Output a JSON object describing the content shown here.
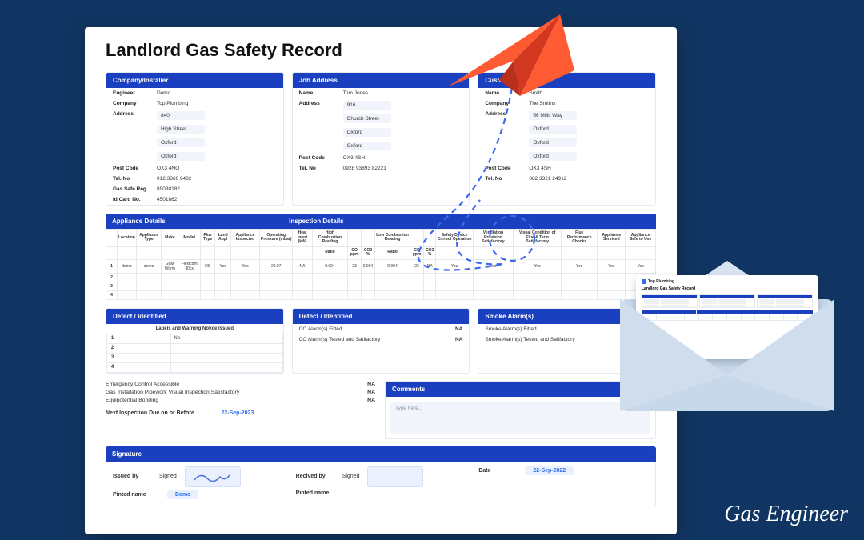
{
  "title": "Landlord Gas Safety Record",
  "cards": {
    "company": {
      "header": "Company/Installer",
      "engineer_k": "Engineer",
      "engineer_v": "Demo",
      "company_k": "Company",
      "company_v": "Top Plumbing",
      "address_k": "Address",
      "addr1": "840",
      "addr2": "High Street",
      "addr3": "Oxford",
      "addr4": "Oxford",
      "postcode_k": "Post Code",
      "postcode_v": "OX3 4NQ",
      "tel_k": "Tel. No",
      "tel_v": "012 3366 9482",
      "gas_k": "Gas Safe Reg",
      "gas_v": "89030182",
      "id_k": "Id Card No.",
      "id_v": "4501862"
    },
    "job": {
      "header": "Job Address",
      "name_k": "Name",
      "name_v": "Tom Jones",
      "address_k": "Address",
      "addr1": "916",
      "addr2": "Church Street",
      "addr3": "Oxford",
      "addr4": "Oxford",
      "postcode_k": "Post Code",
      "postcode_v": "OX3 4SH",
      "tel_k": "Tel. No",
      "tel_v": "0928 93893 82221"
    },
    "customer": {
      "header": "Customer/Landlord",
      "name_k": "Name",
      "name_v": "Smith",
      "company_k": "Company",
      "company_v": "The Smiths",
      "address_k": "Address",
      "addr1": "56 Mills Way",
      "addr2": "Oxford",
      "addr3": "Oxford",
      "addr4": "Oxford",
      "postcode_k": "Post Code",
      "postcode_v": "OX3 4SH",
      "tel_k": "Tel. No",
      "tel_v": "082 3321 24912"
    }
  },
  "appliance_hdr": "Appliance Details",
  "inspection_hdr": "Inspection Details",
  "wide_headers": [
    "",
    "Location",
    "Appliance Type",
    "Make",
    "Model",
    "Flue Type",
    "Land Appl",
    "Appliance Inspected",
    "Operating Pressure (mbar)",
    "Heat Input (kW)",
    "High Combustion Reading",
    "",
    "",
    "Low Combustion Reading",
    "",
    "",
    "Safety Device Correct Operation",
    "Ventilation Provision Satisfactory",
    "Visual Condition of Flue & Term Satisfactory",
    "Flue Performance Checks",
    "Appliance Serviced",
    "Appliance Safe to Use"
  ],
  "wide_sub": [
    "",
    "",
    "",
    "",
    "",
    "",
    "",
    "",
    "",
    "",
    "Ratio",
    "CO ppm",
    "CO2 %",
    "Ratio",
    "CO ppm",
    "CO2 %",
    "",
    "",
    "",
    "",
    "",
    ""
  ],
  "wide_rows": [
    [
      "1",
      "demo",
      "demo",
      "Glow Worm",
      "Flexicom 30cx",
      "RS",
      "Yes",
      "Yes",
      "20.07",
      "NA",
      "0.004",
      "23",
      "0.004",
      "0.004",
      "23",
      "NA",
      "Yes",
      "Yes",
      "Yes",
      "Yes",
      "Yes",
      "Yes"
    ],
    [
      "2",
      "",
      "",
      "",
      "",
      "",
      "",
      "",
      "",
      "",
      "",
      "",
      "",
      "",
      "",
      "",
      "",
      "",
      "",
      "",
      "",
      ""
    ],
    [
      "3",
      "",
      "",
      "",
      "",
      "",
      "",
      "",
      "",
      "",
      "",
      "",
      "",
      "",
      "",
      "",
      "",
      "",
      "",
      "",
      "",
      ""
    ],
    [
      "4",
      "",
      "",
      "",
      "",
      "",
      "",
      "",
      "",
      "",
      "",
      "",
      "",
      "",
      "",
      "",
      "",
      "",
      "",
      "",
      "",
      ""
    ]
  ],
  "defect1_hdr": "Defect / Identified",
  "defect1_sub": "Labels and Warning Notice Issued",
  "defect1_col": "No",
  "defect2_hdr": "Defect / Identified",
  "defect2_rows": [
    {
      "l": "CO Alarm(s) Fitted",
      "r": "NA"
    },
    {
      "l": "CO Alarm(s) Tested and Satifactory",
      "r": "NA"
    }
  ],
  "smoke_hdr": "Smoke Alarm(s)",
  "smoke_rows": [
    {
      "l": "Smoke Alarm(s) Fitted",
      "r": ""
    },
    {
      "l": "Smoke Alarm(s) Tested and Satifactory",
      "r": ""
    }
  ],
  "checks": [
    {
      "l": "Emergency Control Accessible",
      "r": "NA"
    },
    {
      "l": "Gas Installation Pipework Visual Inspection Satisfactory",
      "r": "NA"
    },
    {
      "l": "Equipotential Bonding",
      "r": "NA"
    }
  ],
  "next_k": "Next Inspection Due on or Before",
  "next_v": "22-Sep-2023",
  "comments_hdr": "Comments",
  "comments_ph": "Type here...",
  "sig_hdr": "Signature",
  "issued_k": "Issued by",
  "signed_k": "Signed",
  "recv_k": "Recived by",
  "date_k": "Date",
  "date_v": "22-Sep-2022",
  "printed_k": "Pinted name",
  "printed_v": "Demo",
  "brand": "Gas Engineer",
  "mini_company": "Top Plumbing"
}
